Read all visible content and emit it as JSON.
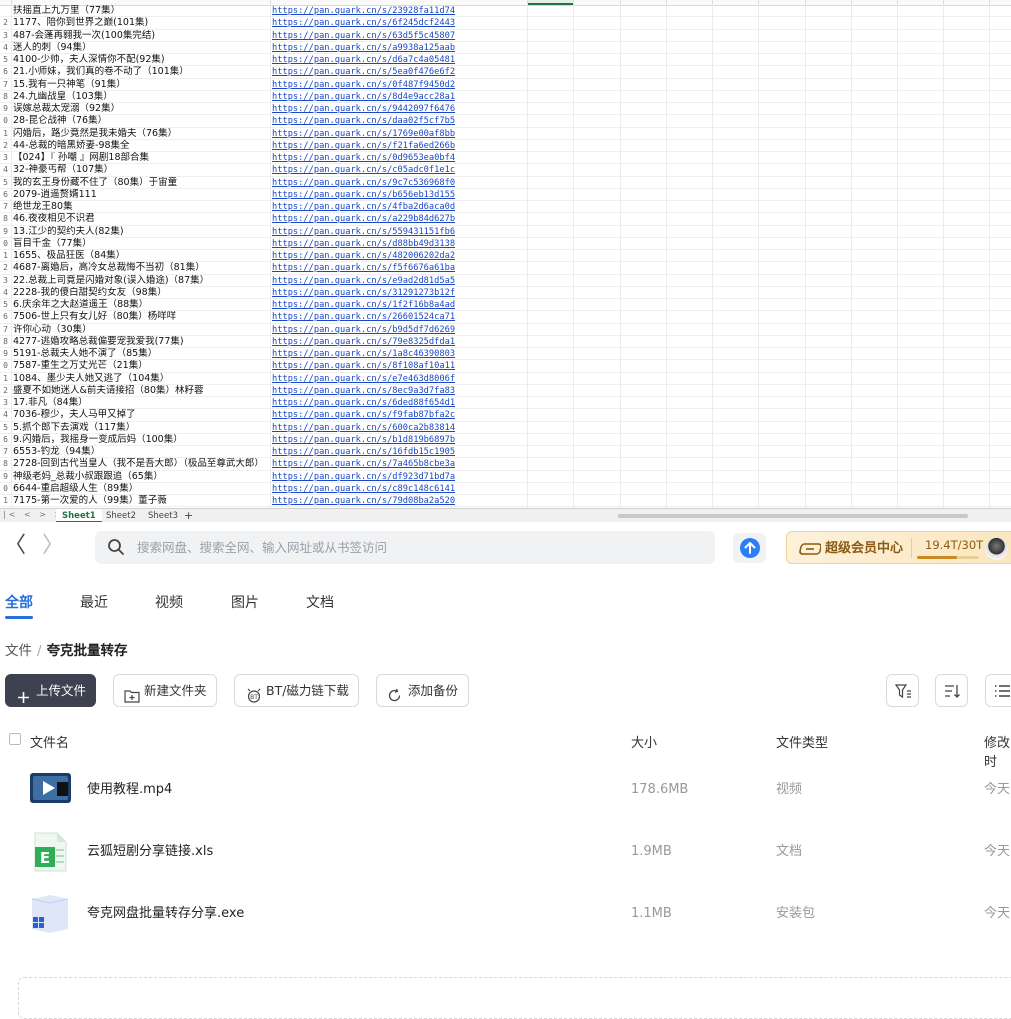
{
  "spreadsheet": {
    "rows": [
      {
        "n": "",
        "title": "扶摇直上九万里（77集）",
        "link": "https://pan.quark.cn/s/23928fa11d74"
      },
      {
        "n": "2",
        "title": "1177、陪你到世界之巅(101集)",
        "link": "https://pan.quark.cn/s/6f245dcf2443"
      },
      {
        "n": "3",
        "title": "487-会蓬再翱我一次(100集完结)",
        "link": "https://pan.quark.cn/s/63d5f5c45807"
      },
      {
        "n": "4",
        "title": "迷人的刺（94集）",
        "link": "https://pan.quark.cn/s/a9938a125aab"
      },
      {
        "n": "5",
        "title": "4100-少帅，夫人深情你不配(92集)",
        "link": "https://pan.quark.cn/s/d6a7c4a05481"
      },
      {
        "n": "6",
        "title": "21.小师妹，我们真的卷不动了（101集）",
        "link": "https://pan.quark.cn/s/5ea0f476e6f2"
      },
      {
        "n": "7",
        "title": "15.我有一只神笔（91集）",
        "link": "https://pan.quark.cn/s/0f487f9450d2"
      },
      {
        "n": "8",
        "title": "24.九幽战皇（103集）",
        "link": "https://pan.quark.cn/s/8d4e9acc28a1"
      },
      {
        "n": "9",
        "title": "误嫁总裁太宠溺（92集）",
        "link": "https://pan.quark.cn/s/9442097f6476"
      },
      {
        "n": "0",
        "title": "28-昆仑战神（76集）",
        "link": "https://pan.quark.cn/s/daa02f5cf7b5"
      },
      {
        "n": "1",
        "title": "闪婚后，路少竟然是我未婚夫（76集）",
        "link": "https://pan.quark.cn/s/1769e00af8bb"
      },
      {
        "n": "2",
        "title": "44-总裁的暗黑娇妻-98集全",
        "link": "https://pan.quark.cn/s/f21fa6ed266b"
      },
      {
        "n": "3",
        "title": "【024】『 孙嘲 』网剧18部合集",
        "link": "https://pan.quark.cn/s/0d9653ea0bf4"
      },
      {
        "n": "4",
        "title": "32-神豪丐帮（107集）",
        "link": "https://pan.quark.cn/s/c05adc0f1e1c"
      },
      {
        "n": "5",
        "title": "我的玄王身份藏不住了（80集）于宙童",
        "link": "https://pan.quark.cn/s/9c7c536968f0"
      },
      {
        "n": "6",
        "title": "2079-逍遥赘婿111",
        "link": "https://pan.quark.cn/s/b656eb13d155"
      },
      {
        "n": "7",
        "title": "绝世龙王80集",
        "link": "https://pan.quark.cn/s/4fba2d6aca0d"
      },
      {
        "n": "8",
        "title": "46.夜夜相见不识君",
        "link": "https://pan.quark.cn/s/a229b84d627b"
      },
      {
        "n": "9",
        "title": "13.江少的契约夫人(82集)",
        "link": "https://pan.quark.cn/s/559431151fb6"
      },
      {
        "n": "0",
        "title": "盲目千金（77集）",
        "link": "https://pan.quark.cn/s/d88bb49d3138"
      },
      {
        "n": "1",
        "title": "1655、极品狂医（84集）",
        "link": "https://pan.quark.cn/s/482006202da2"
      },
      {
        "n": "2",
        "title": "4687-离婚后，高冷女总裁悔不当初（81集）",
        "link": "https://pan.quark.cn/s/f5f6676a61ba"
      },
      {
        "n": "3",
        "title": "22.总裁上司竟是闪婚对象(误入婚途)（87集）",
        "link": "https://pan.quark.cn/s/e9ad2d81d5a5"
      },
      {
        "n": "4",
        "title": "2228-我的傻白甜契约女友（98集）",
        "link": "https://pan.quark.cn/s/31291273b12f"
      },
      {
        "n": "5",
        "title": "6.庆余年之大赵道遥王（88集）",
        "link": "https://pan.quark.cn/s/1f2f16b8a4ad"
      },
      {
        "n": "6",
        "title": "7506-世上只有女儿好（80集）杨咩咩",
        "link": "https://pan.quark.cn/s/26601524ca71"
      },
      {
        "n": "7",
        "title": "许你心动（30集）",
        "link": "https://pan.quark.cn/s/b9d5df7d6269"
      },
      {
        "n": "8",
        "title": "4277-逃婚攻略总裁偏要宠我爱我(77集)",
        "link": "https://pan.quark.cn/s/79e8325dfda1"
      },
      {
        "n": "9",
        "title": "5191-总裁夫人她不演了（85集）",
        "link": "https://pan.quark.cn/s/1a8c46390803"
      },
      {
        "n": "0",
        "title": "7587-重生之万丈光芒（21集）",
        "link": "https://pan.quark.cn/s/8f108af10a11"
      },
      {
        "n": "1",
        "title": "1084、墨少夫人她又逃了（104集）",
        "link": "https://pan.quark.cn/s/e7e463d8006f"
      },
      {
        "n": "2",
        "title": "盛夏不如她迷人&前夫请接招（80集）林籽蓉",
        "link": "https://pan.quark.cn/s/8ec9a3d7fa83"
      },
      {
        "n": "3",
        "title": "17.非凡（84集）",
        "link": "https://pan.quark.cn/s/6ded88f654d1"
      },
      {
        "n": "4",
        "title": "7036-穆少，夫人马甲又掉了",
        "link": "https://pan.quark.cn/s/f9fab87bfa2c"
      },
      {
        "n": "5",
        "title": "5.抓个郎下去演戏（117集）",
        "link": "https://pan.quark.cn/s/600ca2b83814"
      },
      {
        "n": "6",
        "title": "9.闪婚后，我摇身一变成后妈（100集）",
        "link": "https://pan.quark.cn/s/b1d819b6897b"
      },
      {
        "n": "7",
        "title": "6553-钓龙（94集）",
        "link": "https://pan.quark.cn/s/16fdb15c1905"
      },
      {
        "n": "8",
        "title": "2728-回到古代当皇人（我不是吾大郎）（极品至尊武大郎）",
        "link": "https://pan.quark.cn/s/7a465b8cbe3a"
      },
      {
        "n": "9",
        "title": "神级老妈_总裁小叔跟跟追（65集）",
        "link": "https://pan.quark.cn/s/df923d71bd7a"
      },
      {
        "n": "0",
        "title": "6644-重启超级人生（89集）",
        "link": "https://pan.quark.cn/s/c89c148c6141"
      },
      {
        "n": "1",
        "title": "7175-第一次爱的人（99集）董子薇",
        "link": "https://pan.quark.cn/s/79d08ba2a520"
      }
    ],
    "sheet_nav": "|< < > >|",
    "tabs": [
      "Sheet1",
      "Sheet2",
      "Sheet3"
    ],
    "add_tab": "+"
  },
  "browser": {
    "back": "〈",
    "forward": "〉",
    "search_placeholder": "搜索网盘、搜索全网、输入网址或从书签访问",
    "vip_label": "超级会员中心",
    "quota": "19.4T/30T",
    "quota_used_fraction": 0.647
  },
  "category_tabs": [
    "全部",
    "最近",
    "视频",
    "图片",
    "文档"
  ],
  "breadcrumb": {
    "root": "文件",
    "separator": "/",
    "current": "夸克批量转存"
  },
  "actions": {
    "upload": "上传文件",
    "new_folder": "新建文件夹",
    "bt": "BT/磁力链下载",
    "backup": "添加备份"
  },
  "table": {
    "headers": {
      "name": "文件名",
      "size": "大小",
      "type": "文件类型",
      "modified": "修改时"
    },
    "files": [
      {
        "name": "使用教程.mp4",
        "size": "178.6MB",
        "type": "视频",
        "modified": "今天",
        "icon": "video-icon"
      },
      {
        "name": "云狐短剧分享链接.xls",
        "size": "1.9MB",
        "type": "文档",
        "modified": "今天",
        "icon": "excel-icon"
      },
      {
        "name": "夸克网盘批量转存分享.exe",
        "size": "1.1MB",
        "type": "安装包",
        "modified": "今天",
        "icon": "exe-icon"
      }
    ]
  },
  "colors": {
    "accent": "#2a6fdc",
    "upload_btn": "#3d4150",
    "excel_green": "#217346",
    "link": "#1a47c8"
  }
}
